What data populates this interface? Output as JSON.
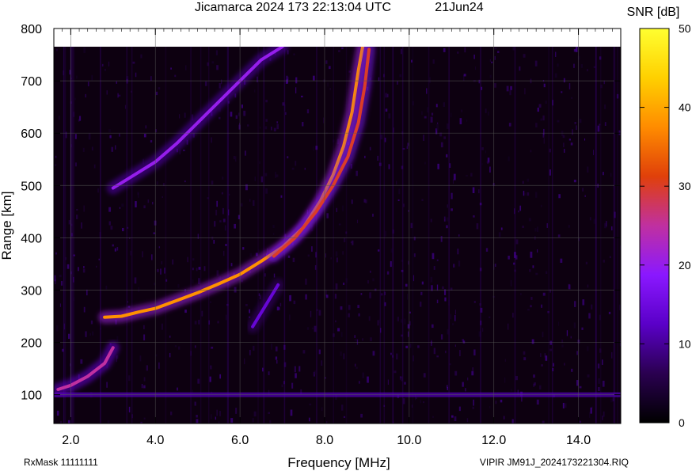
{
  "header": {
    "title": "Jicamarca 2024 173 22:13:04 UTC",
    "date": "21Jun24"
  },
  "footer": {
    "left": "RxMask 11111111",
    "right": "VIPIR  JM91J_2024173221304.RIQ"
  },
  "chart_data": {
    "type": "heatmap",
    "xlabel": "Frequency [MHz]",
    "ylabel": "Range [km]",
    "xlim": [
      1.6,
      15.0
    ],
    "ylim": [
      45,
      800
    ],
    "x_ticks": [
      "2.0",
      "4.0",
      "6.0",
      "8.0",
      "10.0",
      "12.0",
      "14.0"
    ],
    "x_tick_values": [
      2,
      4,
      6,
      8,
      10,
      12,
      14
    ],
    "y_ticks": [
      "100",
      "200",
      "300",
      "400",
      "500",
      "600",
      "700",
      "800"
    ],
    "y_tick_values": [
      100,
      200,
      300,
      400,
      500,
      600,
      700,
      800
    ],
    "grid": true,
    "colorbar": {
      "label": "SNR [dB]",
      "range": [
        0,
        50
      ],
      "ticks": [
        "0",
        "10",
        "20",
        "30",
        "40",
        "50"
      ],
      "tick_values": [
        0,
        10,
        20,
        30,
        40,
        50
      ],
      "colors": [
        "#000000",
        "#2a0050",
        "#5a00c8",
        "#8a18ff",
        "#c030a0",
        "#e0400a",
        "#ff8c00",
        "#ffd000",
        "#ffff30"
      ]
    },
    "traces": [
      {
        "feature": "O-mode F-layer trace",
        "snr_db": 38,
        "points": [
          [
            2.8,
            248
          ],
          [
            3.2,
            250
          ],
          [
            3.6,
            258
          ],
          [
            4.0,
            265
          ],
          [
            4.5,
            280
          ],
          [
            5.0,
            295
          ],
          [
            5.5,
            312
          ],
          [
            6.0,
            330
          ],
          [
            6.5,
            355
          ],
          [
            7.0,
            382
          ],
          [
            7.5,
            420
          ],
          [
            7.9,
            470
          ],
          [
            8.2,
            520
          ],
          [
            8.45,
            575
          ],
          [
            8.65,
            640
          ],
          [
            8.8,
            720
          ],
          [
            8.9,
            765
          ]
        ]
      },
      {
        "feature": "X-mode trace",
        "snr_db": 30,
        "points": [
          [
            6.8,
            365
          ],
          [
            7.3,
            400
          ],
          [
            7.8,
            450
          ],
          [
            8.2,
            500
          ],
          [
            8.55,
            555
          ],
          [
            8.8,
            620
          ],
          [
            8.95,
            690
          ],
          [
            9.05,
            760
          ]
        ]
      },
      {
        "feature": "second hop echo",
        "snr_db": 20,
        "points": [
          [
            3.0,
            495
          ],
          [
            3.5,
            520
          ],
          [
            4.0,
            545
          ],
          [
            4.5,
            580
          ],
          [
            5.0,
            620
          ],
          [
            5.5,
            660
          ],
          [
            6.0,
            700
          ],
          [
            6.5,
            740
          ],
          [
            7.0,
            765
          ]
        ]
      },
      {
        "feature": "E-layer trace",
        "snr_db": 25,
        "points": [
          [
            1.7,
            110
          ],
          [
            2.0,
            118
          ],
          [
            2.4,
            135
          ],
          [
            2.8,
            160
          ],
          [
            3.0,
            190
          ]
        ]
      },
      {
        "feature": "faint trace",
        "snr_db": 14,
        "points": [
          [
            6.3,
            230
          ],
          [
            6.6,
            270
          ],
          [
            6.9,
            310
          ]
        ]
      }
    ],
    "background_band": {
      "feature": "ground echo band",
      "range_km": 100,
      "snr_db": 12
    }
  }
}
